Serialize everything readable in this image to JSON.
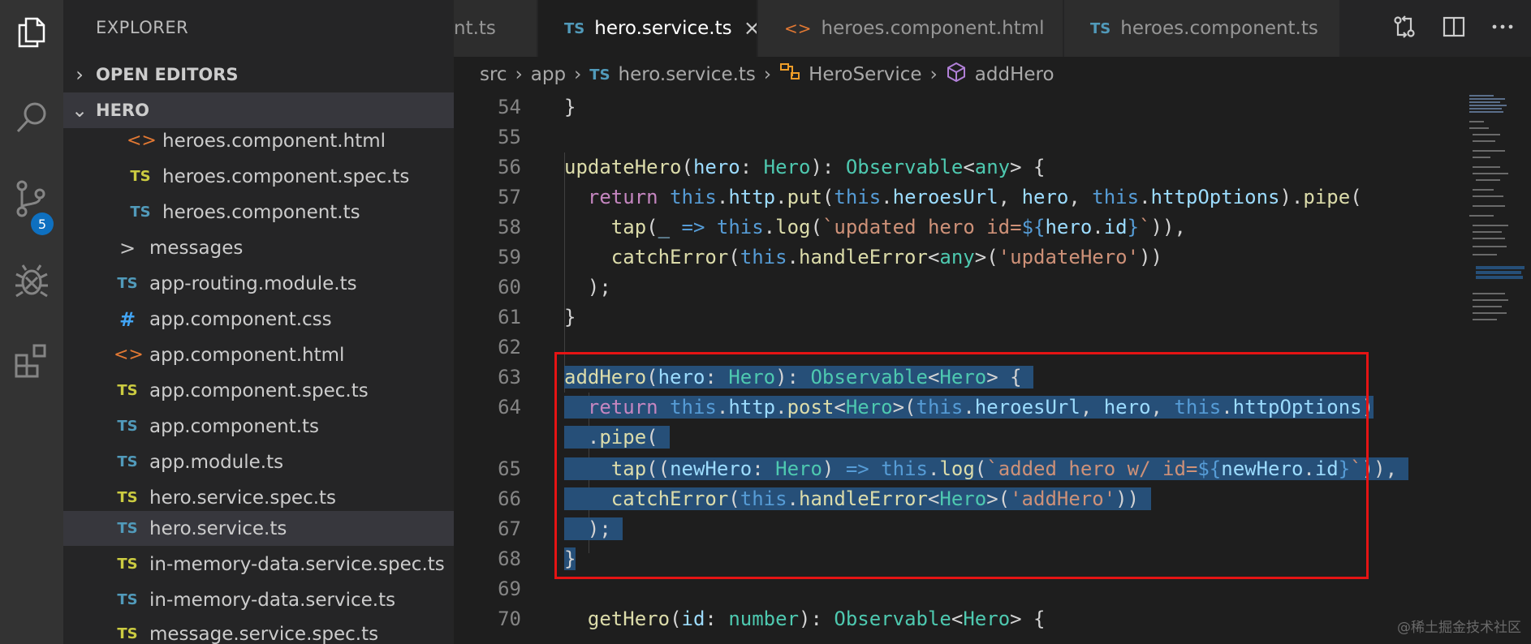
{
  "activity_bar": {
    "scm_badge": "5"
  },
  "sidebar": {
    "title": "EXPLORER",
    "open_editors_label": "OPEN EDITORS",
    "project_label": "HERO",
    "tree": [
      {
        "icon": "<>",
        "label": "heroes.component.html"
      },
      {
        "icon": "TS",
        "label": "heroes.component.spec.ts"
      },
      {
        "icon": "TS",
        "label": "heroes.component.ts"
      },
      {
        "icon": ">",
        "label": "messages"
      },
      {
        "icon": "TS",
        "label": "app-routing.module.ts"
      },
      {
        "icon": "#",
        "label": "app.component.css"
      },
      {
        "icon": "<>",
        "label": "app.component.html"
      },
      {
        "icon": "TS",
        "label": "app.component.spec.ts"
      },
      {
        "icon": "TS",
        "label": "app.component.ts"
      },
      {
        "icon": "TS",
        "label": "app.module.ts"
      },
      {
        "icon": "TS",
        "label": "hero.service.spec.ts"
      },
      {
        "icon": "TS",
        "label": "hero.service.ts"
      },
      {
        "icon": "TS",
        "label": "in-memory-data.service.spec.ts"
      },
      {
        "icon": "TS",
        "label": "in-memory-data.service.ts"
      },
      {
        "icon": "TS",
        "label": "message.service.spec.ts"
      }
    ]
  },
  "tabs": [
    {
      "label": "nt.ts"
    },
    {
      "icon": "TS",
      "label": "hero.service.ts",
      "close": "×"
    },
    {
      "icon": "<>",
      "label": "heroes.component.html"
    },
    {
      "icon": "TS",
      "label": "heroes.component.ts"
    }
  ],
  "breadcrumb": [
    "src",
    "app",
    "hero.service.ts",
    "HeroService",
    "addHero"
  ],
  "breadcrumb_ts_icon": "TS",
  "gutter": {
    "l54": "54",
    "l55": "55",
    "l56": "56",
    "l57": "57",
    "l58": "58",
    "l59": "59",
    "l60": "60",
    "l61": "61",
    "l62": "62",
    "l63": "63",
    "l64": "64",
    "l65": "65",
    "l66": "66",
    "l67": "67",
    "l68": "68",
    "l69": "69",
    "l70": "70"
  },
  "watermark": "@稀土掘金技术社区",
  "colors": {
    "highlight_box": "#e51414",
    "selection": "#264f78",
    "accent_badge": "#0e70c0"
  }
}
